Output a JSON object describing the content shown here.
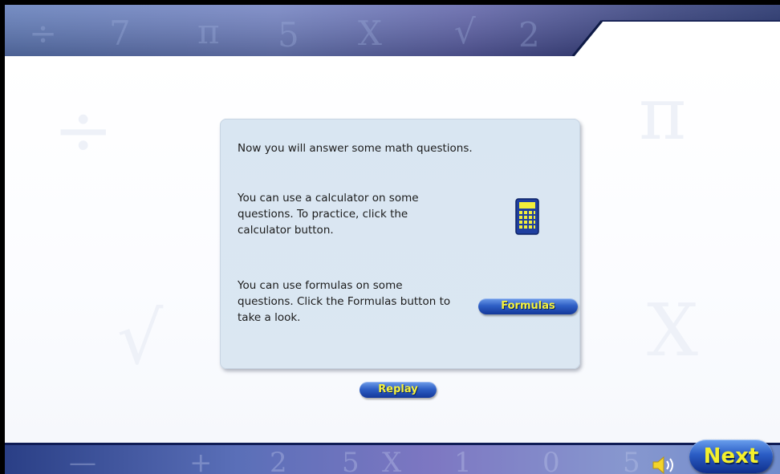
{
  "panel": {
    "intro": "Now you will answer some math questions.",
    "calculator_text": "You can use a calculator on some questions. To practice, click the calculator button.",
    "formula_text": "You can use formulas on some questions. Click the Formulas button to take a look."
  },
  "buttons": {
    "formulas": "Formulas",
    "replay": "Replay",
    "next": "Next"
  },
  "icons": {
    "calculator": "calculator-icon",
    "speaker": "speaker-icon"
  },
  "colors": {
    "button_blue": "#2f60c6",
    "button_text_yellow": "#f6f23a",
    "panel_background": "#d9e6f2",
    "banner_dark": "#1b2d6b"
  }
}
